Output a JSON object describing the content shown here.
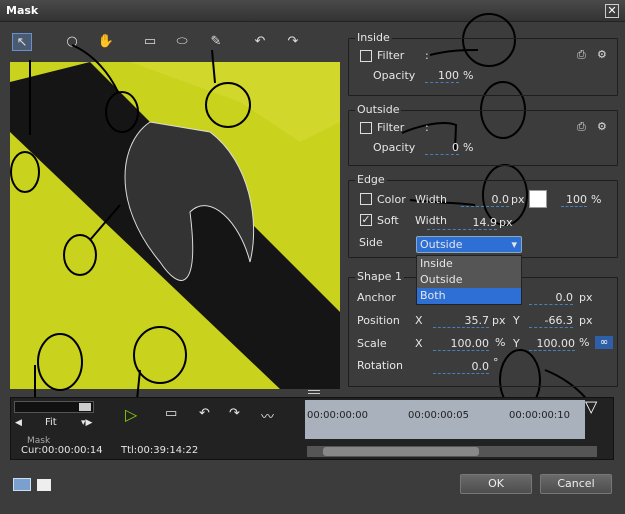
{
  "window": {
    "title": "Mask",
    "close": "✕"
  },
  "toolbar": {
    "tools": [
      {
        "icon": "select-arrow-icon",
        "glyph": "↖"
      },
      {
        "icon": "zoom-icon",
        "glyph": "○"
      },
      {
        "icon": "hand-icon",
        "glyph": "✋"
      },
      {
        "icon": "rectangle-icon",
        "glyph": "▭"
      },
      {
        "icon": "ellipse-icon",
        "glyph": "⬭"
      },
      {
        "icon": "pen-icon",
        "glyph": "✎"
      },
      {
        "icon": "undo-icon",
        "glyph": "↶"
      },
      {
        "icon": "redo-icon",
        "glyph": "↷"
      }
    ]
  },
  "inside": {
    "title": "Inside",
    "filter_label": "Filter",
    "filter_colon": ":",
    "filter_checked": false,
    "opacity_label": "Opacity",
    "opacity": "100",
    "opacity_unit": "%"
  },
  "outside": {
    "title": "Outside",
    "filter_label": "Filter",
    "filter_colon": ":",
    "filter_checked": false,
    "opacity_label": "Opacity",
    "opacity": "0",
    "opacity_unit": "%"
  },
  "edge": {
    "title": "Edge",
    "color_label": "Color",
    "color_checked": false,
    "color_width_label": "Width",
    "color_width": "0.0",
    "color_width_unit": "px",
    "color_swatch": "#ffffff",
    "color_opacity": "100",
    "color_opacity_unit": "%",
    "soft_label": "Soft",
    "soft_checked": true,
    "soft_width_label": "Width",
    "soft_width": "14.9",
    "soft_width_unit": "px",
    "side_label": "Side",
    "side_value": "Outside",
    "side_options": [
      "Inside",
      "Outside",
      "Both"
    ]
  },
  "shape": {
    "title": "Shape 1",
    "anchor_label": "Anchor",
    "anchor": "0.0",
    "anchor_unit": "px",
    "position_label": "Position",
    "x_label": "X",
    "y_label": "Y",
    "pos_x": "35.7",
    "pos_y": "-66.3",
    "pos_unit": "px",
    "scale_label": "Scale",
    "scale_x": "100.00",
    "scale_y": "100.00",
    "scale_unit": "%",
    "rotation_label": "Rotation",
    "rotation": "0.0",
    "rotation_unit": "°"
  },
  "timeline": {
    "zoom_value": "Fit",
    "track_label": "Mask",
    "current": "Cur:00:00:00:14",
    "total": "Ttl:00:39:14:22",
    "ticks": [
      "00:00:00:00",
      "00:00:00:05",
      "00:00:00:10"
    ]
  },
  "buttons": {
    "ok": "OK",
    "cancel": "Cancel"
  },
  "annotations": [
    "9",
    "8",
    "2",
    "2",
    "3",
    "4",
    "5",
    "6",
    "10",
    "7"
  ]
}
